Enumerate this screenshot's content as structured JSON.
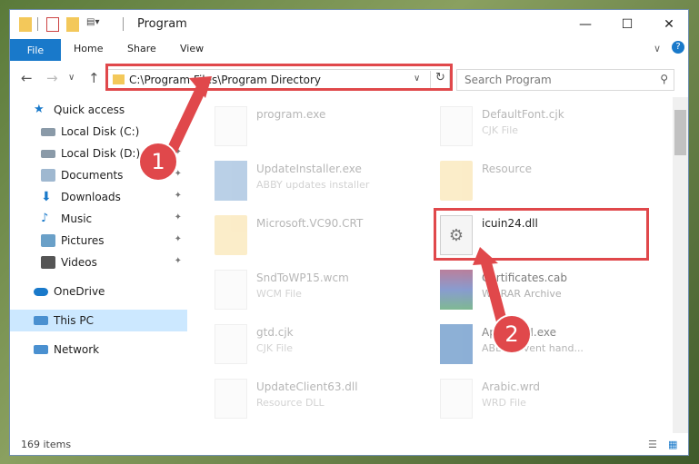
{
  "window": {
    "title": "Program"
  },
  "controls": {
    "minimize": "—",
    "maximize": "☐",
    "close": "✕"
  },
  "ribbon": {
    "file": "File",
    "tabs": [
      "Home",
      "Share",
      "View"
    ],
    "chevron": "∨",
    "help": "?"
  },
  "nav": {
    "back": "←",
    "forward": "→",
    "recent": "∨",
    "up": "↑"
  },
  "address": {
    "path": "C:\\Program Files\\Program Directory",
    "dropdown": "∨",
    "refresh": "↻"
  },
  "search": {
    "placeholder": "Search Program"
  },
  "sidebar": {
    "items": [
      {
        "label": "Quick access",
        "icon": "star-icon",
        "pinned": false
      },
      {
        "label": "Local Disk (C:)",
        "icon": "disk-icon",
        "pinned": true
      },
      {
        "label": "Local Disk (D:)",
        "icon": "disk-icon",
        "pinned": true
      },
      {
        "label": "Documents",
        "icon": "documents-icon",
        "pinned": true
      },
      {
        "label": "Downloads",
        "icon": "download-icon",
        "pinned": true
      },
      {
        "label": "Music",
        "icon": "music-icon",
        "pinned": true
      },
      {
        "label": "Pictures",
        "icon": "pictures-icon",
        "pinned": true
      },
      {
        "label": "Videos",
        "icon": "videos-icon",
        "pinned": true
      },
      {
        "label": "OneDrive",
        "icon": "cloud-icon",
        "pinned": false
      },
      {
        "label": "This PC",
        "icon": "computer-icon",
        "pinned": false
      },
      {
        "label": "Network",
        "icon": "network-icon",
        "pinned": false
      }
    ],
    "pin_glyph": "📌"
  },
  "files": [
    {
      "name": "program.exe",
      "type": ""
    },
    {
      "name": "DefaultFont.cjk",
      "type": "CJK File"
    },
    {
      "name": "UpdateInstaller.exe",
      "type": "ABBY updates installer"
    },
    {
      "name": "Resource",
      "type": ""
    },
    {
      "name": "Microsoft.VC90.CRT",
      "type": ""
    },
    {
      "name": "icuin24.dll",
      "type": ""
    },
    {
      "name": "SndToWP15.wcm",
      "type": "WCM File"
    },
    {
      "name": "Certificates.cab",
      "type": "WinRAR Archive"
    },
    {
      "name": "gtd.cjk",
      "type": "CJK File"
    },
    {
      "name": "AppendTI.exe",
      "type": "ABBYY event hand..."
    },
    {
      "name": "UpdateClient63.dll",
      "type": "Resource DLL"
    },
    {
      "name": "Arabic.wrd",
      "type": "WRD File"
    }
  ],
  "status": {
    "count": "169 items"
  },
  "annotations": {
    "step1": "1",
    "step2": "2"
  },
  "colors": {
    "accent": "#1979ca",
    "annotation_red": "#e0484b",
    "selection": "#cce8ff"
  }
}
